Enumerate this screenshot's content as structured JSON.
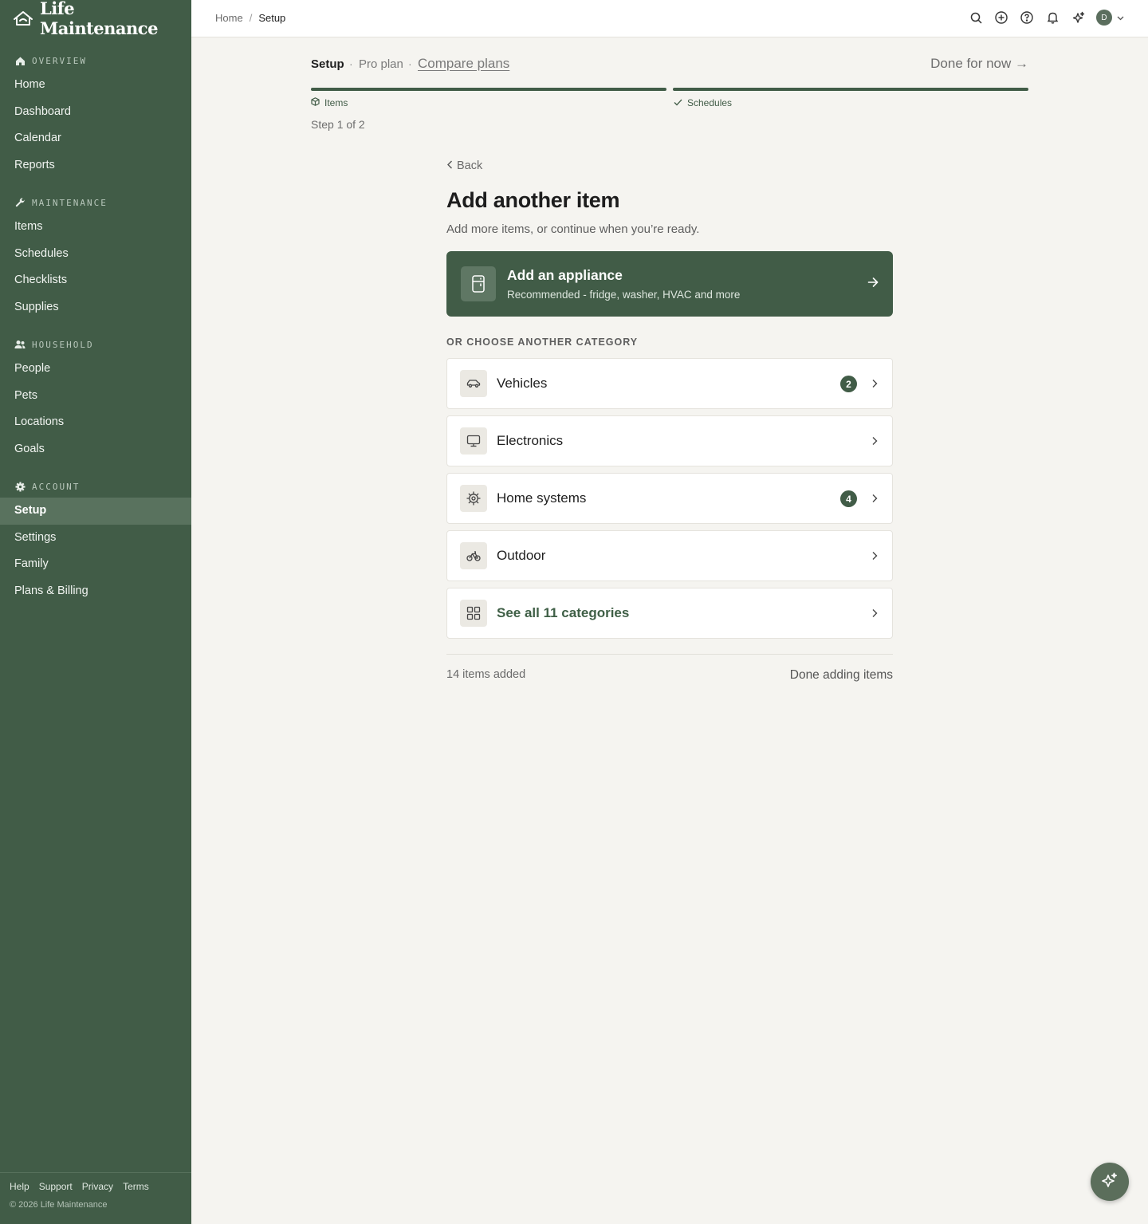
{
  "app": {
    "name": "Life Maintenance"
  },
  "sidebar": {
    "sections": [
      {
        "heading": "OVERVIEW",
        "icon": "home-icon",
        "items": [
          "Home",
          "Dashboard",
          "Calendar",
          "Reports"
        ]
      },
      {
        "heading": "MAINTENANCE",
        "icon": "wrench-icon",
        "items": [
          "Items",
          "Schedules",
          "Checklists",
          "Supplies"
        ]
      },
      {
        "heading": "HOUSEHOLD",
        "icon": "people-icon",
        "items": [
          "People",
          "Pets",
          "Locations",
          "Goals"
        ]
      },
      {
        "heading": "ACCOUNT",
        "icon": "gear-icon",
        "items": [
          "Setup",
          "Settings",
          "Family",
          "Plans & Billing"
        ]
      }
    ],
    "active_item": "Setup",
    "footer": {
      "links": [
        "Help",
        "Support",
        "Privacy",
        "Terms"
      ],
      "copyright": "© 2026 Life Maintenance"
    }
  },
  "topbar": {
    "breadcrumb": {
      "home": "Home",
      "separator": "/",
      "current": "Setup"
    },
    "icons": [
      "search-icon",
      "add-circle-icon",
      "help-icon",
      "bell-icon",
      "sparkle-icon"
    ],
    "user_initial": "D"
  },
  "setup": {
    "title": "Setup",
    "dot": "·",
    "plan": "Pro plan",
    "compare": "Compare plans",
    "done_for_now": "Done for now →",
    "steps": [
      {
        "label": "Items",
        "icon": "box-icon",
        "complete": 1.0
      },
      {
        "label": "Schedules",
        "icon": "check-icon",
        "complete": 1.0
      }
    ],
    "step_count": "Step 1 of 2"
  },
  "main": {
    "back": "Back",
    "heading": "Add another item",
    "subheading": "Add more items, or continue when you’re ready.",
    "featured": {
      "title": "Add an appliance",
      "subtitle": "Recommended - fridge, washer, HVAC and more",
      "icon": "fridge-icon"
    },
    "or_label": "OR CHOOSE ANOTHER CATEGORY",
    "categories": [
      {
        "label": "Vehicles",
        "icon": "car-icon",
        "count": "2"
      },
      {
        "label": "Electronics",
        "icon": "monitor-icon",
        "count": ""
      },
      {
        "label": "Home systems",
        "icon": "cog-icon",
        "count": "4"
      },
      {
        "label": "Outdoor",
        "icon": "bicycle-icon",
        "count": ""
      }
    ],
    "see_all": {
      "label": "See all 11 categories",
      "icon": "grid-icon"
    },
    "items_added": "14 items added",
    "done_adding": "Done adding items"
  },
  "colors": {
    "brand_green": "#415c47",
    "background": "#f5f4f0"
  }
}
